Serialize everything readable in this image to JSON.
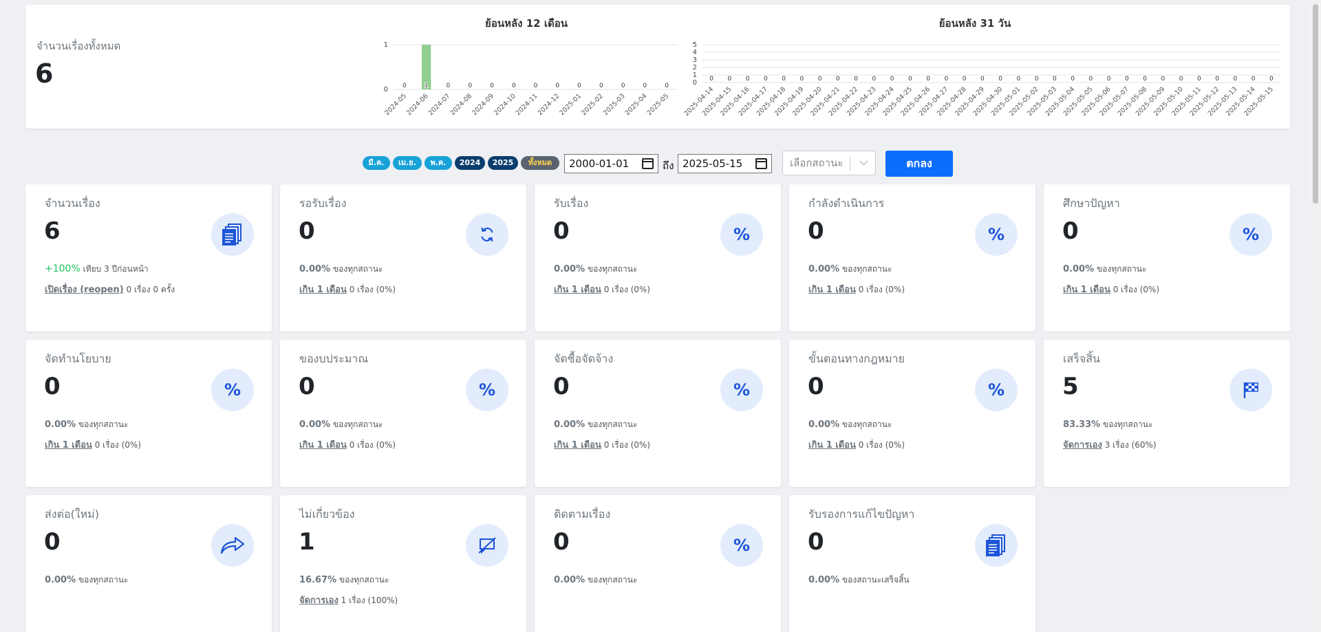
{
  "summary": {
    "total_label": "จำนวนเรื่องทั้งหมด",
    "total_value": "6"
  },
  "chart_data": [
    {
      "type": "bar",
      "title": "ย้อนหลัง 12 เดือน",
      "categories": [
        "2024-05",
        "2024-06",
        "2024-07",
        "2024-08",
        "2024-09",
        "2024-10",
        "2024-11",
        "2024-12",
        "2025-01",
        "2025-02",
        "2025-03",
        "2025-04",
        "2025-05"
      ],
      "values": [
        0,
        1,
        0,
        0,
        0,
        0,
        0,
        0,
        0,
        0,
        0,
        0,
        0
      ],
      "ylim": [
        0,
        1
      ],
      "yticks": [
        0,
        1
      ],
      "bar_color": "#8fcf8f"
    },
    {
      "type": "bar",
      "title": "ย้อนหลัง 31 วัน",
      "categories": [
        "2025-04-14",
        "2025-04-15",
        "2025-04-16",
        "2025-04-17",
        "2025-04-18",
        "2025-04-19",
        "2025-04-20",
        "2025-04-21",
        "2025-04-22",
        "2025-04-23",
        "2025-04-24",
        "2025-04-25",
        "2025-04-26",
        "2025-04-27",
        "2025-04-28",
        "2025-04-29",
        "2025-04-30",
        "2025-05-01",
        "2025-05-02",
        "2025-05-03",
        "2025-05-04",
        "2025-05-05",
        "2025-05-06",
        "2025-05-07",
        "2025-05-08",
        "2025-05-09",
        "2025-05-10",
        "2025-05-11",
        "2025-05-12",
        "2025-05-13",
        "2025-05-14",
        "2025-05-15"
      ],
      "values": [
        0,
        0,
        0,
        0,
        0,
        0,
        0,
        0,
        0,
        0,
        0,
        0,
        0,
        0,
        0,
        0,
        0,
        0,
        0,
        0,
        0,
        0,
        0,
        0,
        0,
        0,
        0,
        0,
        0,
        0,
        0,
        0
      ],
      "ylim": [
        0,
        5
      ],
      "yticks": [
        0,
        1,
        2,
        3,
        4,
        5
      ],
      "bar_color": "#8fcf8f"
    }
  ],
  "filters": {
    "pills": [
      {
        "label": "มี.ค.",
        "color": "#17a2d8",
        "text_color": "#ffffff"
      },
      {
        "label": "เม.ย.",
        "color": "#17a2d8",
        "text_color": "#ffffff"
      },
      {
        "label": "พ.ค.",
        "color": "#17a2d8",
        "text_color": "#ffffff"
      },
      {
        "label": "2024",
        "color": "#0b3d6e",
        "text_color": "#ffffff"
      },
      {
        "label": "2025",
        "color": "#0b3d6e",
        "text_color": "#ffffff"
      },
      {
        "label": "ทั้งหมด",
        "color": "#5a6370",
        "text_color": "#ffd34d"
      }
    ],
    "date_from": "2000-01-01",
    "to_label": "ถึง",
    "date_to": "2025-05-15",
    "status_placeholder": "เลือกสถานะ",
    "ok_label": "ตกลง"
  },
  "cards": [
    {
      "title": "จำนวนเรื่อง",
      "value": "6",
      "icon": "documents-icon",
      "line1_value": "+100%",
      "line1_text": "เทียบ 3 ปีก่อนหน้า",
      "line1_green": true,
      "line2_link": "เปิดเรื่อง (reopen)",
      "line2_text": "0 เรื่อง 0 ครั้ง"
    },
    {
      "title": "รอรับเรื่อง",
      "value": "0",
      "icon": "refresh-icon",
      "line1_value": "0.00%",
      "line1_text": "ของทุกสถานะ",
      "line2_link": "เกิน 1 เดือน",
      "line2_text": "0 เรื่อง (0%)"
    },
    {
      "title": "รับเรื่อง",
      "value": "0",
      "icon": "percent-icon",
      "line1_value": "0.00%",
      "line1_text": "ของทุกสถานะ",
      "line2_link": "เกิน 1 เดือน",
      "line2_text": "0 เรื่อง (0%)"
    },
    {
      "title": "กำลังดำเนินการ",
      "value": "0",
      "icon": "percent-icon",
      "line1_value": "0.00%",
      "line1_text": "ของทุกสถานะ",
      "line2_link": "เกิน 1 เดือน",
      "line2_text": "0 เรื่อง (0%)"
    },
    {
      "title": "ศึกษาปัญหา",
      "value": "0",
      "icon": "percent-icon",
      "line1_value": "0.00%",
      "line1_text": "ของทุกสถานะ",
      "line2_link": "เกิน 1 เดือน",
      "line2_text": "0 เรื่อง (0%)"
    },
    {
      "title": "จัดทำนโยบาย",
      "value": "0",
      "icon": "percent-icon",
      "line1_value": "0.00%",
      "line1_text": "ของทุกสถานะ",
      "line2_link": "เกิน 1 เดือน",
      "line2_text": "0 เรื่อง (0%)"
    },
    {
      "title": "ของบประมาณ",
      "value": "0",
      "icon": "percent-icon",
      "line1_value": "0.00%",
      "line1_text": "ของทุกสถานะ",
      "line2_link": "เกิน 1 เดือน",
      "line2_text": "0 เรื่อง (0%)"
    },
    {
      "title": "จัดซื้อจัดจ้าง",
      "value": "0",
      "icon": "percent-icon",
      "line1_value": "0.00%",
      "line1_text": "ของทุกสถานะ",
      "line2_link": "เกิน 1 เดือน",
      "line2_text": "0 เรื่อง (0%)"
    },
    {
      "title": "ขั้นตอนทางกฎหมาย",
      "value": "0",
      "icon": "percent-icon",
      "line1_value": "0.00%",
      "line1_text": "ของทุกสถานะ",
      "line2_link": "เกิน 1 เดือน",
      "line2_text": "0 เรื่อง (0%)"
    },
    {
      "title": "เสร็จสิ้น",
      "value": "5",
      "icon": "checkered-flag-icon",
      "line1_value": "83.33%",
      "line1_text": "ของทุกสถานะ",
      "line2_link": "จัดการเอง",
      "line2_text": "3 เรื่อง (60%)"
    },
    {
      "title": "ส่งต่อ(ใหม่)",
      "value": "0",
      "icon": "share-arrow-icon",
      "line1_value": "0.00%",
      "line1_text": "ของทุกสถานะ"
    },
    {
      "title": "ไม่เกี่ยวข้อง",
      "value": "1",
      "icon": "chat-off-icon",
      "line1_value": "16.67%",
      "line1_text": "ของทุกสถานะ",
      "line2_link": "จัดการเอง",
      "line2_text": "1 เรื่อง (100%)"
    },
    {
      "title": "ติดตามเรื่อง",
      "value": "0",
      "icon": "percent-icon",
      "line1_value": "0.00%",
      "line1_text": "ของทุกสถานะ"
    },
    {
      "title": "รับรองการแก้ไขปัญหา",
      "value": "0",
      "icon": "documents-icon",
      "line1_value": "0.00%",
      "line1_text": "ของสถานะเสร็จสิ้น"
    }
  ]
}
